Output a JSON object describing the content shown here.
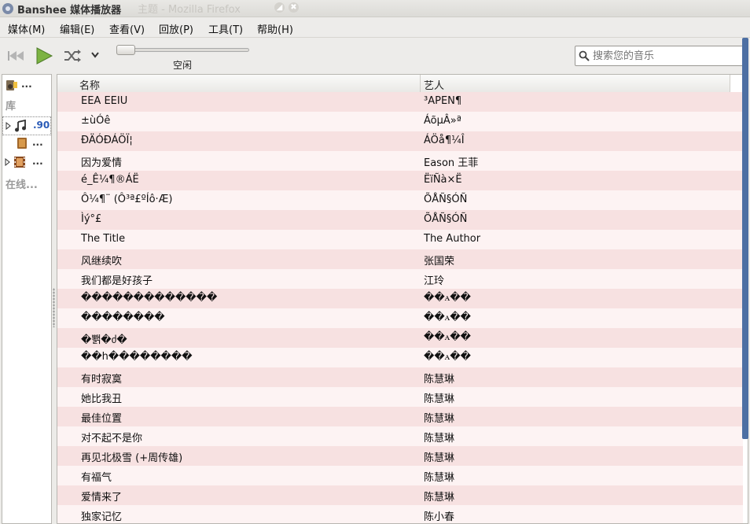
{
  "window": {
    "title": "Banshee 媒体播放器",
    "background_title": "主题 - Mozilla Firefox",
    "close_glyph": "✖",
    "minimize_glyph": "◢"
  },
  "menubar": {
    "items": [
      {
        "label": "媒体(M)"
      },
      {
        "label": "编辑(E)"
      },
      {
        "label": "查看(V)"
      },
      {
        "label": "回放(P)"
      },
      {
        "label": "工具(T)"
      },
      {
        "label": "帮助(H)"
      }
    ]
  },
  "toolbar": {
    "status": "空闲",
    "search_placeholder": "搜索您的音乐",
    "seek_position": 0
  },
  "sidebar": {
    "top_item": "...",
    "library_header": "库",
    "music_count": ".90",
    "audiobooks": "...",
    "videos": "...",
    "online_header": "在线..."
  },
  "columns": {
    "title": "名称",
    "artist": "艺人"
  },
  "tracks": [
    {
      "title": "EEA EEIU",
      "artist": "³APEN¶"
    },
    {
      "title": "±ùÓê",
      "artist": "ÁõµÂ»ª"
    },
    {
      "title": "ÐÄÓÐÁÖÏ¦",
      "artist": "ÁÖå¶¼Î"
    },
    {
      "title": "因为爱情",
      "artist": "Eason 王菲"
    },
    {
      "title": "é_Ê¼¶®ÁË",
      "artist": "ËïÑà×Ë"
    },
    {
      "title": "Ô¼¶¨ (Ô³ª£ºÍô·Æ)",
      "artist": "ÕÅÑ§ÓÑ"
    },
    {
      "title": "Ìý°£",
      "artist": "ÕÅÑ§ÓÑ"
    },
    {
      "title": "The Title",
      "artist": "The Author"
    },
    {
      "title": "风继续吹",
      "artist": "张国荣"
    },
    {
      "title": "我们都是好孩子",
      "artist": "江玲"
    },
    {
      "title": "�������������",
      "artist": "��ꭺ��"
    },
    {
      "title": "��������",
      "artist": "��ꭺ��"
    },
    {
      "title": "�뾁�ძ�",
      "artist": "��ꭺ��"
    },
    {
      "title": "��h��������",
      "artist": "��ꭺ��"
    },
    {
      "title": "有时寂寞",
      "artist": "陈慧琳"
    },
    {
      "title": "她比我丑",
      "artist": "陈慧琳"
    },
    {
      "title": "最佳位置",
      "artist": "陈慧琳"
    },
    {
      "title": "对不起不是你",
      "artist": "陈慧琳"
    },
    {
      "title": "再见北极雪 (+周传雄)",
      "artist": "陈慧琳"
    },
    {
      "title": "有福气",
      "artist": "陈慧琳"
    },
    {
      "title": "爱情来了",
      "artist": "陈慧琳"
    },
    {
      "title": "独家记忆",
      "artist": "陈小春"
    }
  ],
  "colors": {
    "row_odd": "#f7e1e1",
    "row_even": "#fdf3f3",
    "play_green": "#6aa84f",
    "scroll_blue": "#4d6fa3"
  }
}
